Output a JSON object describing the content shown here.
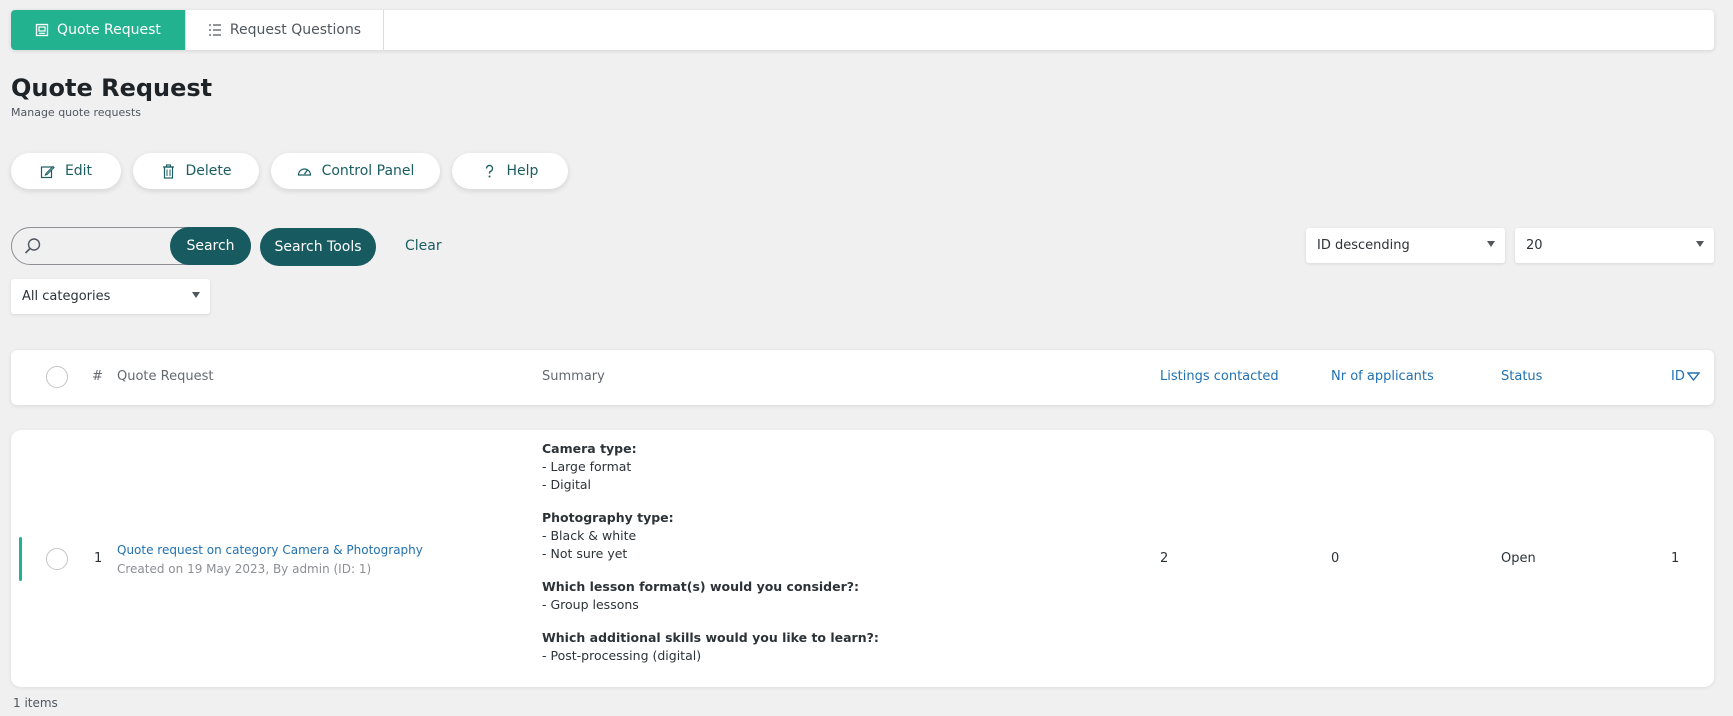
{
  "tabs": [
    {
      "label": "Quote Request",
      "icon": "quote-request-icon",
      "active": true
    },
    {
      "label": "Request Questions",
      "icon": "list-icon",
      "active": false
    }
  ],
  "page": {
    "title": "Quote Request",
    "subtitle": "Manage quote requests"
  },
  "actions": {
    "edit": "Edit",
    "delete": "Delete",
    "control_panel": "Control Panel",
    "help": "Help"
  },
  "search": {
    "value": "",
    "submit_label": "Search",
    "tools_label": "Search Tools",
    "clear_label": "Clear"
  },
  "sort": {
    "order": "ID descending",
    "per_page": "20",
    "category": "All categories"
  },
  "table": {
    "headers": {
      "num": "#",
      "quote_request": "Quote Request",
      "summary": "Summary",
      "listings_contacted": "Listings contacted",
      "nr_applicants": "Nr of applicants",
      "status": "Status",
      "id": "ID"
    },
    "rows": [
      {
        "num": "1",
        "title": "Quote request on category Camera & Photography",
        "meta": "Created on 19 May 2023, By admin (ID: 1)",
        "summary": [
          {
            "question": "Camera type:",
            "answers": [
              "- Large format",
              "- Digital"
            ]
          },
          {
            "question": "Photography type:",
            "answers": [
              "- Black & white",
              "- Not sure yet"
            ]
          },
          {
            "question": "Which lesson format(s) would you consider?:",
            "answers": [
              "- Group lessons"
            ]
          },
          {
            "question": "Which additional skills would you like to learn?:",
            "answers": [
              "- Post-processing (digital)"
            ]
          }
        ],
        "listings_contacted": "2",
        "nr_applicants": "0",
        "status": "Open",
        "id": "1"
      }
    ]
  },
  "footer": {
    "items_count": "1 items"
  },
  "colors": {
    "accent": "#22b28f",
    "dark_teal": "#175a5f",
    "link": "#2271b1",
    "background": "#f0f0f1"
  }
}
